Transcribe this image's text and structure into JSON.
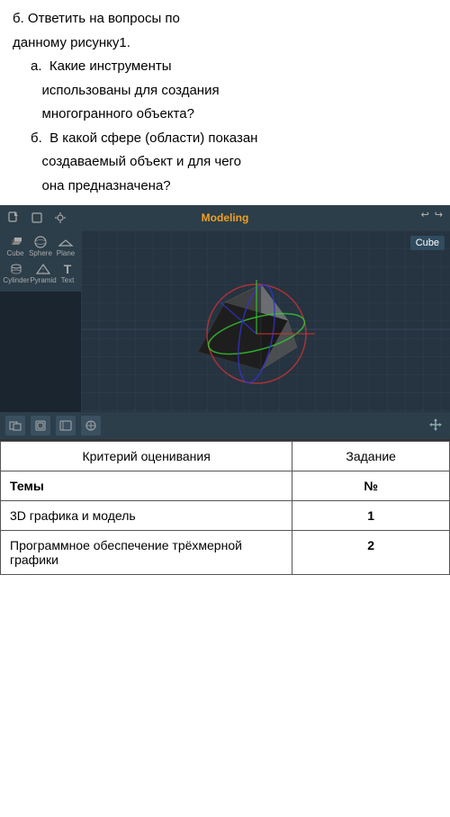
{
  "text": {
    "line1": "б.      Ответить на вопросы по",
    "line2": "данному рисунку1.",
    "lineA_label": "а.",
    "lineA_text1": "Какие инструменты",
    "lineA_text2": "использованы для создания",
    "lineA_text3": "многогранного объекта?",
    "lineB_label": "б.",
    "lineB_text1": "В какой сфере (области) показан",
    "lineB_text2": "создаваемый объект и для чего",
    "lineB_text3": "она предназначена?"
  },
  "toolbar": {
    "mode": "Modeling",
    "undo_icon": "↩",
    "redo_icon": "↪",
    "cube_label": "Cube"
  },
  "tools": {
    "row1": [
      {
        "icon": "⬛",
        "label": "Cube"
      },
      {
        "icon": "⭕",
        "label": "Sphere"
      },
      {
        "icon": "◺",
        "label": "Plane"
      }
    ],
    "row2": [
      {
        "icon": "⌇",
        "label": "Cylinder"
      },
      {
        "icon": "△",
        "label": "Pyramid"
      },
      {
        "icon": "T",
        "label": "Text"
      }
    ]
  },
  "bottom_bar": {
    "icons": [
      "□",
      "□",
      "□",
      "□"
    ],
    "move_icon": "⊹"
  },
  "table": {
    "header": {
      "col1": "Критерий оценивания",
      "col2": "Задание"
    },
    "rows": [
      {
        "col1": "Темы",
        "col2": "№"
      },
      {
        "col1": "3D графика и модель",
        "col2": "1"
      },
      {
        "col1": "Программное обеспечение трёхмерной графики",
        "col2": "2"
      }
    ]
  }
}
